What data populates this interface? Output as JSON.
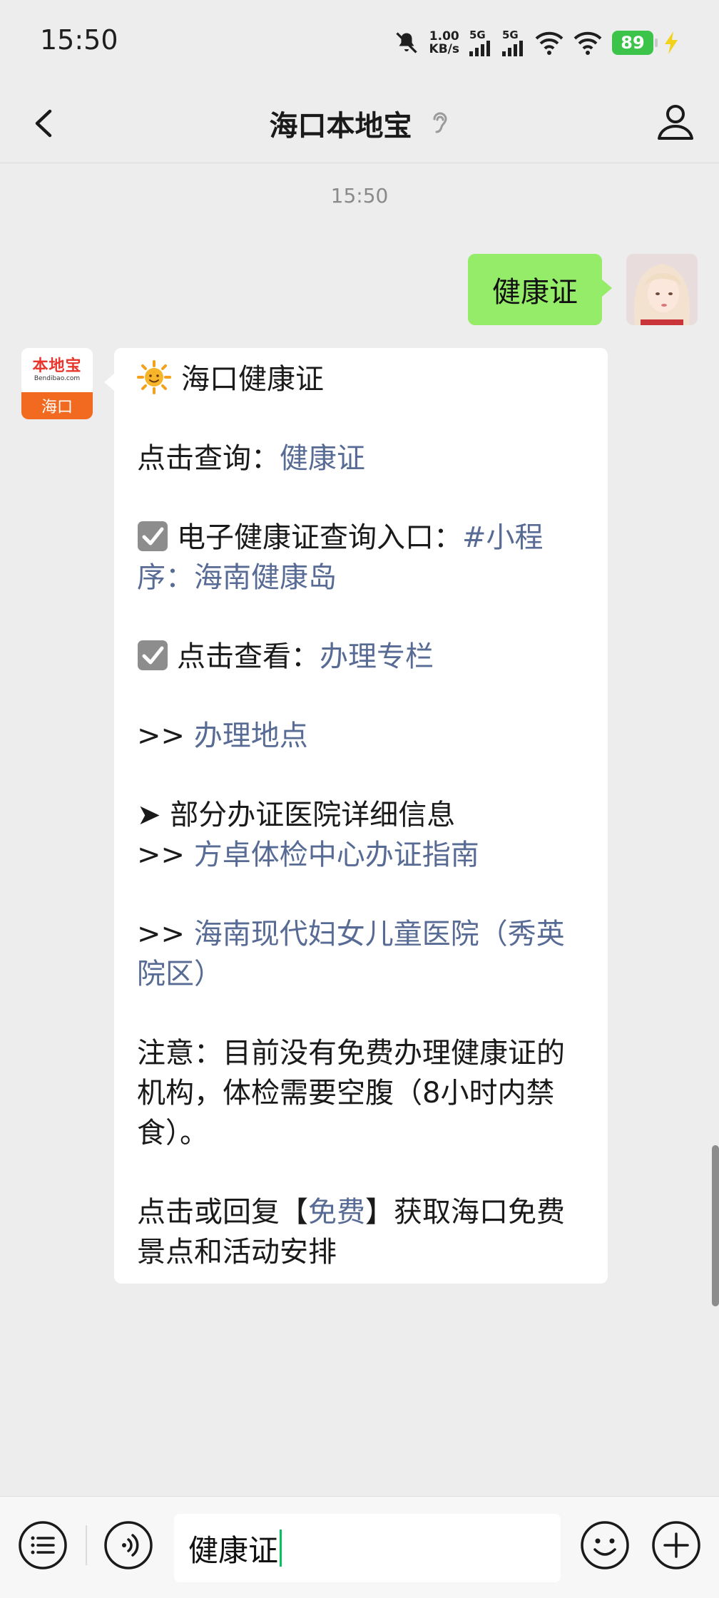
{
  "status_bar": {
    "time": "15:50",
    "net_speed_value": "1.00",
    "net_speed_unit": "KB/s",
    "signal_1": "5G",
    "signal_2": "5G",
    "battery": "89"
  },
  "header": {
    "title": "海口本地宝"
  },
  "chat": {
    "timestamp": "15:50",
    "sent_message": "健康证",
    "bot_avatar": {
      "brand": "本地宝",
      "url": "Bendibao.com",
      "city": "海口"
    },
    "reply": {
      "title": "海口健康证",
      "query_prefix": "点击查询：",
      "query_link": "健康证",
      "ehealth_prefix": "电子健康证查询入口：",
      "ehealth_link": "#小程序：海南健康岛",
      "view_prefix": "点击查看：",
      "view_link": "办理专栏",
      "location_prefix": ">> ",
      "location_link": "办理地点",
      "hospital_heading": "➤ 部分办证医院详细信息",
      "hospital1_prefix": ">> ",
      "hospital1_link": "方卓体检中心办证指南",
      "hospital2_prefix": ">> ",
      "hospital2_link": "海南现代妇女儿童医院（秀英院区）",
      "note": "注意：目前没有免费办理健康证的机构，体检需要空腹（8小时内禁食）。",
      "free_prefix": "点击或回复【",
      "free_link": "免费",
      "free_suffix": "】获取海口免费景点和活动安排"
    }
  },
  "input": {
    "value": "健康证"
  },
  "colors": {
    "background": "#ededed",
    "sent_bubble": "#95ec69",
    "link": "#576b95",
    "caret": "#07c160",
    "battery": "#3cc44a"
  },
  "icons": [
    "mute-bell-icon",
    "signal-icon",
    "wifi-icon",
    "battery-icon",
    "charging-icon",
    "back-arrow-icon",
    "ear-icon",
    "profile-icon",
    "sun-icon",
    "checkbox-icon",
    "menu-list-icon",
    "voice-icon",
    "emoji-icon",
    "plus-icon"
  ]
}
